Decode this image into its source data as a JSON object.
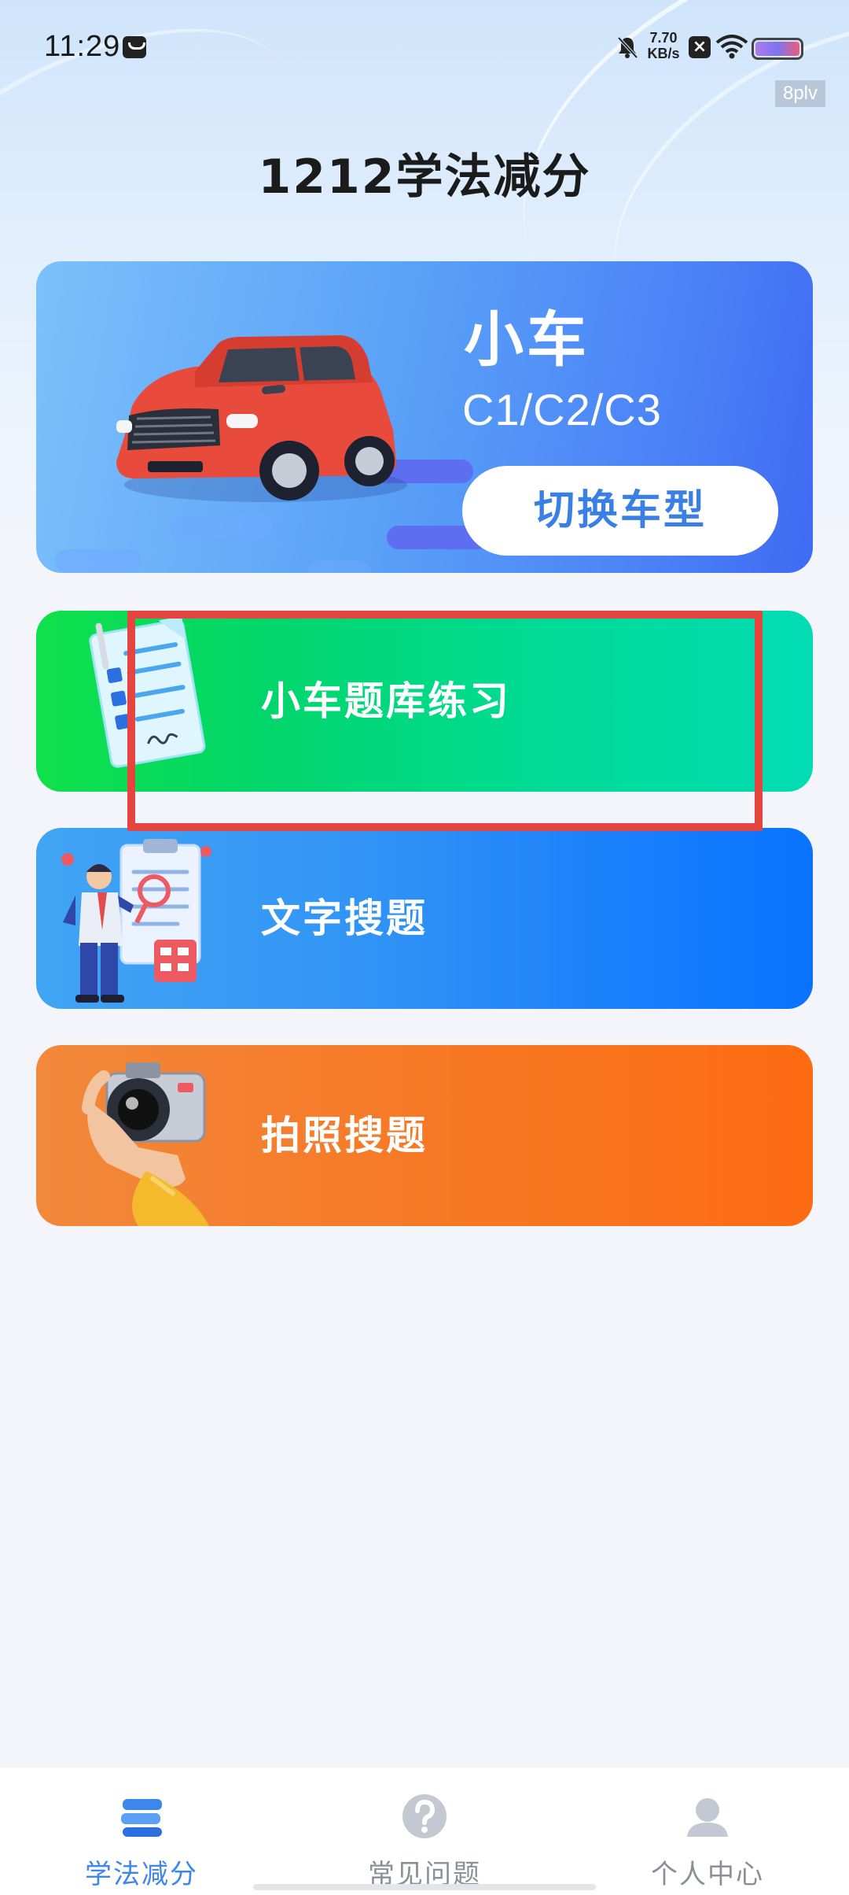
{
  "status_bar": {
    "time": "11:29",
    "net_speed_value": "7.70",
    "net_speed_unit": "KB/s",
    "badge": "8plv"
  },
  "header": {
    "title": "1212学法减分"
  },
  "vehicle_card": {
    "title": "小车",
    "license_classes": "C1/C2/C3",
    "switch_button_label": "切换车型"
  },
  "options": [
    {
      "label": "小车题库练习"
    },
    {
      "label": "文字搜题"
    },
    {
      "label": "拍照搜题"
    }
  ],
  "bottom_nav": {
    "items": [
      {
        "label": "学法减分",
        "icon": "study-icon",
        "active": true
      },
      {
        "label": "常见问题",
        "icon": "question-icon",
        "active": false
      },
      {
        "label": "个人中心",
        "icon": "user-icon",
        "active": false
      }
    ]
  },
  "colors": {
    "accent": "#3d86ee",
    "highlight": "#e6453f",
    "practice_card": "#02d66b",
    "text_search_card": "#1a80fb",
    "photo_search_card": "#fd6b12"
  }
}
